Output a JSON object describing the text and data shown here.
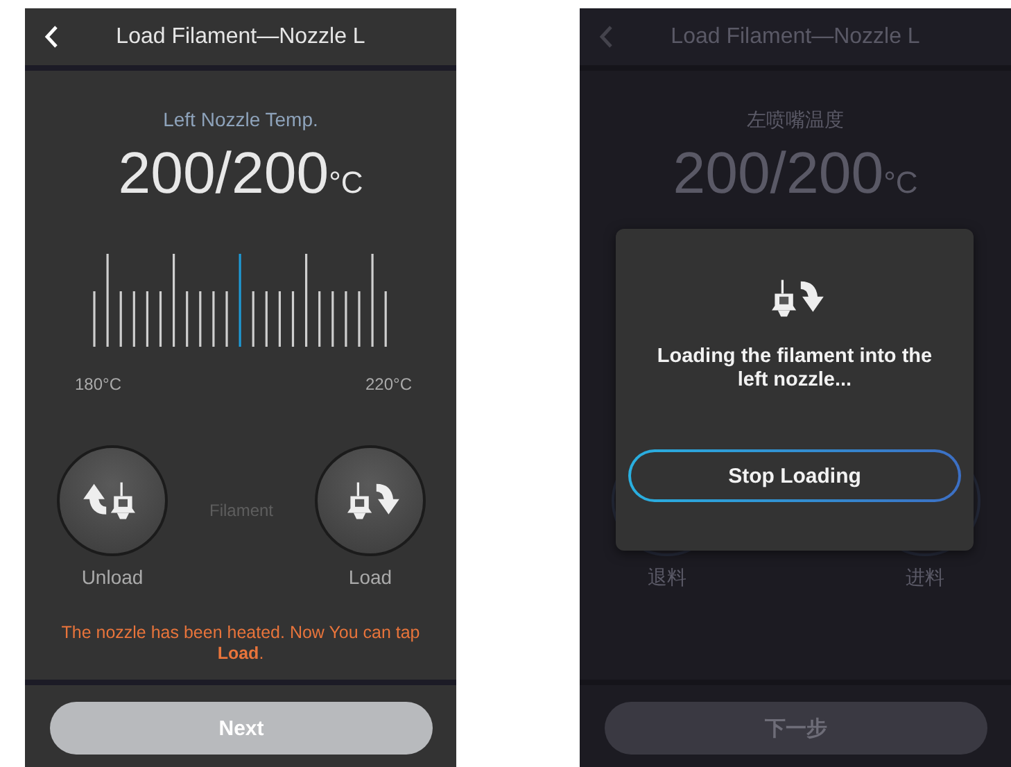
{
  "screens": [
    {
      "title": "Load Filament—Nozzle L",
      "temperature_label": "Left Nozzle Temp.",
      "temperature_reading": "200/200",
      "temperature_unit": "°C",
      "scale": {
        "min_label": "180°C",
        "max_label": "220°C",
        "level": 0.5
      },
      "actions": [
        {
          "kind": "unload",
          "label": "Unload"
        },
        {
          "kind": "load",
          "label": "Load"
        }
      ],
      "filament_label": "Filament",
      "notice": "The nozzle has been heated. Now You can tap **Load**.",
      "next_button": "Next"
    },
    {
      "title": "Load Filament—Nozzle L",
      "temperature_label": "左喷嘴温度",
      "temperature_reading": "200/200",
      "temperature_unit": "°C",
      "actions": [
        {
          "kind": "unload",
          "label": "退料"
        },
        {
          "kind": "load",
          "label": "进料"
        }
      ],
      "next_button": "下一步",
      "dialog": {
        "message": "Loading the filament into the left nozzle...",
        "button": "Stop Loading"
      }
    }
  ]
}
